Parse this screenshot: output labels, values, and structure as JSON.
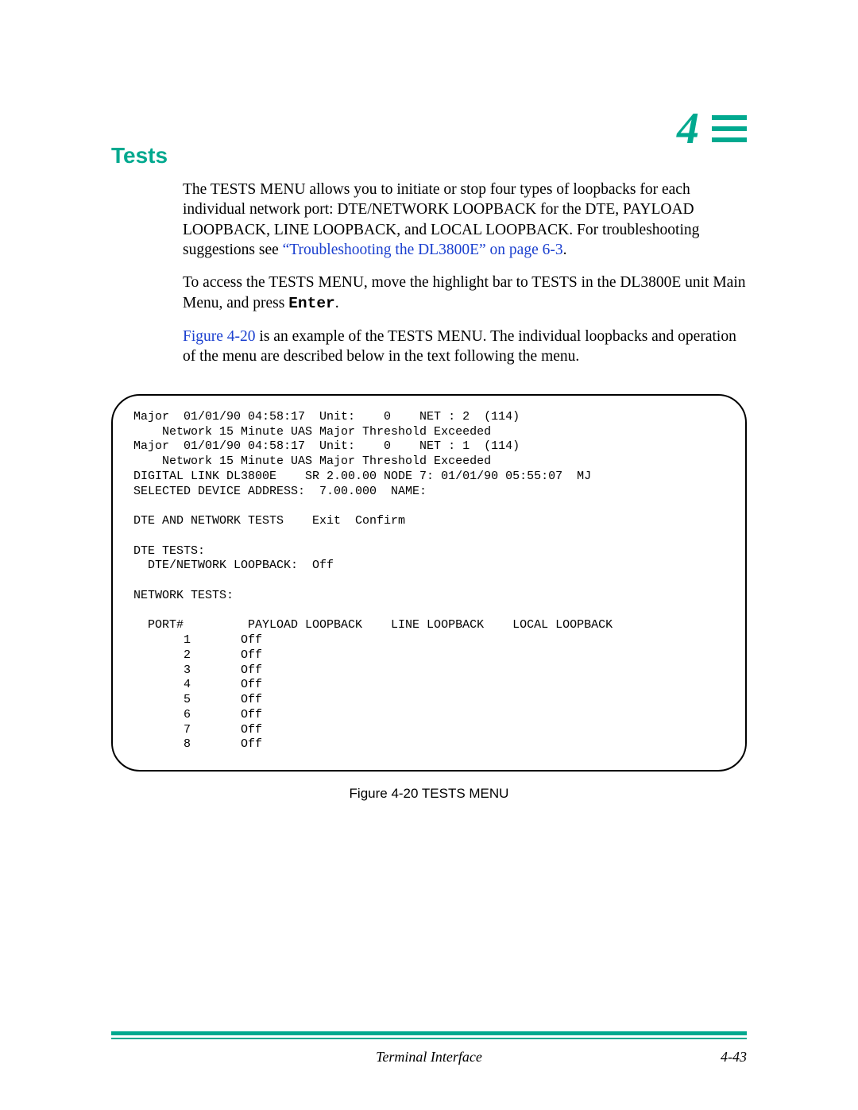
{
  "chapter": {
    "number": "4"
  },
  "section": {
    "title": "Tests"
  },
  "para1": {
    "before_link": "The TESTS MENU allows you to initiate or stop four types of loopbacks for each individual network port: DTE/NETWORK LOOPBACK for the DTE, PAYLOAD LOOPBACK, LINE LOOPBACK, and LOCAL LOOPBACK. For troubleshooting suggestions see ",
    "link": "“Troubleshooting the DL3800E” on page 6-3",
    "after_link": "."
  },
  "para2": {
    "before": "To access the TESTS MENU, move the highlight bar to TESTS in the DL3800E unit Main Menu, and press ",
    "enter": "Enter",
    "after": "."
  },
  "para3": {
    "figlink": "Figure 4-20",
    "after": " is an example of the TESTS MENU. The individual loopbacks and operation of the menu are described below in the text following the menu."
  },
  "terminal": {
    "text": "Major  01/01/90 04:58:17  Unit:    0    NET : 2  (114)\n    Network 15 Minute UAS Major Threshold Exceeded\nMajor  01/01/90 04:58:17  Unit:    0    NET : 1  (114)\n    Network 15 Minute UAS Major Threshold Exceeded\nDIGITAL LINK DL3800E    SR 2.00.00 NODE 7: 01/01/90 05:55:07  MJ\nSELECTED DEVICE ADDRESS:  7.00.000  NAME:\n\nDTE AND NETWORK TESTS    Exit  Confirm\n\nDTE TESTS:\n  DTE/NETWORK LOOPBACK:  Off\n\nNETWORK TESTS:\n\n  PORT#         PAYLOAD LOOPBACK    LINE LOOPBACK    LOCAL LOOPBACK\n       1       Off\n       2       Off\n       3       Off\n       4       Off\n       5       Off\n       6       Off\n       7       Off\n       8       Off"
  },
  "figure_caption": "Figure 4-20  TESTS MENU",
  "footer": {
    "center": "Terminal Interface",
    "right": "4-43"
  }
}
